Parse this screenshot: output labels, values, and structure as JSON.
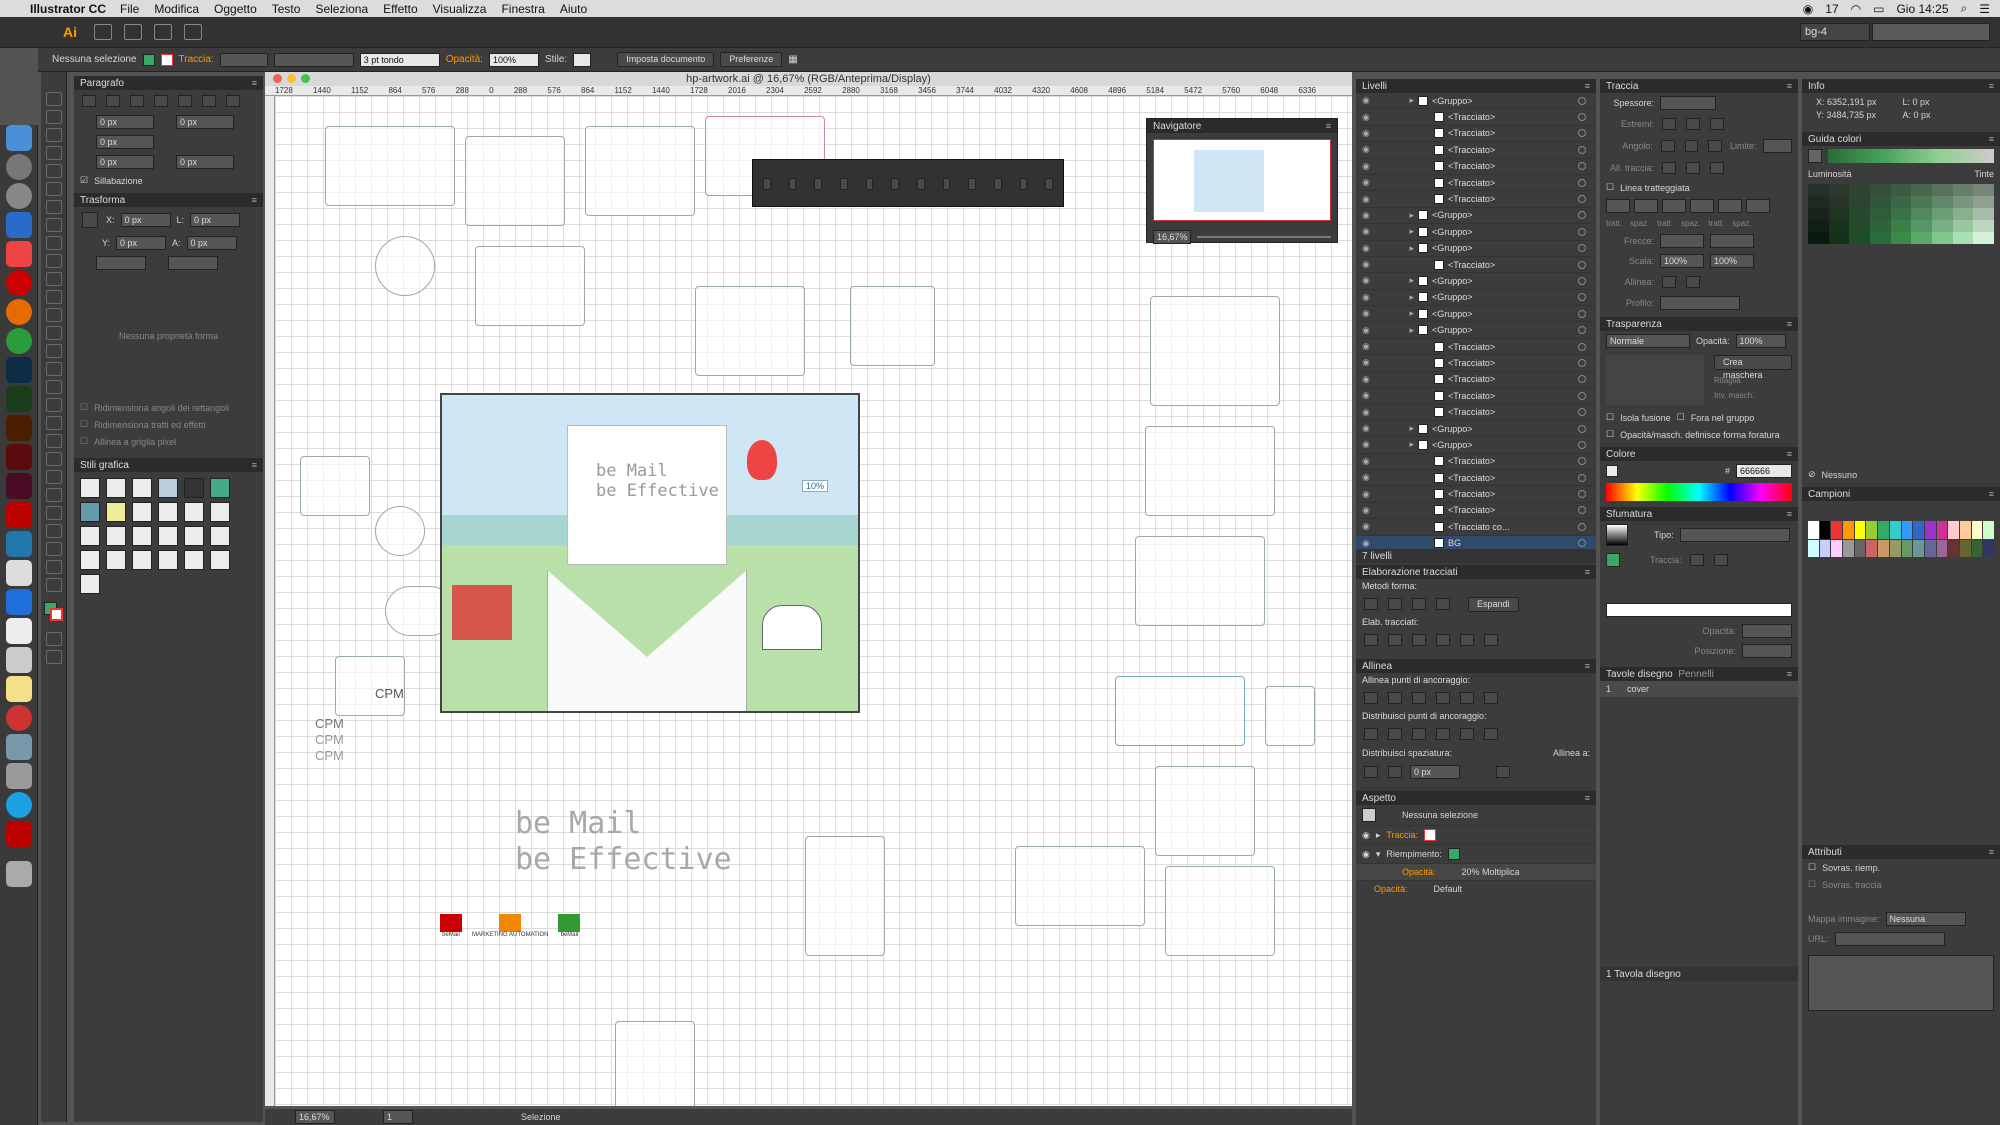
{
  "menubar": {
    "app": "Illustrator CC",
    "items": [
      "File",
      "Modifica",
      "Oggetto",
      "Testo",
      "Seleziona",
      "Effetto",
      "Visualizza",
      "Finestra",
      "Aiuto"
    ],
    "notif_count": "17",
    "clock": "Gio 14:25"
  },
  "appbar": {
    "logo": "Ai",
    "workspace": "bg-4"
  },
  "control": {
    "selection": "Nessuna selezione",
    "stroke_label": "Traccia:",
    "stroke_style": "3 pt tondo",
    "opacity_label": "Opacità:",
    "opacity_value": "100%",
    "style_label": "Stile:",
    "setup_button": "Imposta documento",
    "prefs_button": "Preferenze"
  },
  "paragraph": {
    "title": "Paragrafo",
    "indent_value": "0 px",
    "hyphenation": "Sillabazione"
  },
  "transform": {
    "title": "Trasforma",
    "x_label": "X:",
    "y_label": "Y:",
    "w_label": "L:",
    "h_label": "A:",
    "value": "0 px",
    "no_props": "Nessuna proprietà forma",
    "opt1": "Ridimensiona angoli dei rettangoli",
    "opt2": "Ridimensiona tratti ed effetti",
    "opt3": "Allinea a griglia pixel"
  },
  "graphic_styles": {
    "title": "Stili grafica"
  },
  "document": {
    "title": "hp-artwork.ai @ 16,67% (RGB/Anteprima/Display)",
    "ruler_ticks": [
      "1728",
      "1440",
      "1152",
      "864",
      "576",
      "288",
      "0",
      "288",
      "576",
      "864",
      "1152",
      "1440",
      "1728",
      "2016",
      "2304",
      "2592",
      "2880",
      "3168",
      "3456",
      "3744",
      "4032",
      "4320",
      "4608",
      "4896",
      "5184",
      "5472",
      "5760",
      "6048",
      "6336"
    ],
    "zoom": "16,67%",
    "page": "1",
    "status": "Selezione"
  },
  "artwork": {
    "headline1": "be Mail",
    "headline2": "be Effective",
    "cpm_labels": [
      "CPM",
      "CPM",
      "CPM",
      "CPM"
    ],
    "percent_badge": "10%",
    "logo_labels": [
      "beMail",
      "MARKETING AUTOMATION",
      "beMail"
    ]
  },
  "navigator": {
    "title": "Navigatore",
    "zoom": "16,67%"
  },
  "layers": {
    "title": "Livelli",
    "rows": [
      "<Gruppo>",
      "<Tracciato>",
      "<Tracciato>",
      "<Tracciato>",
      "<Tracciato>",
      "<Tracciato>",
      "<Tracciato>",
      "<Gruppo>",
      "<Gruppo>",
      "<Gruppo>",
      "<Tracciato>",
      "<Gruppo>",
      "<Gruppo>",
      "<Gruppo>",
      "<Gruppo>",
      "<Tracciato>",
      "<Tracciato>",
      "<Tracciato>",
      "<Tracciato>",
      "<Tracciato>",
      "<Gruppo>",
      "<Gruppo>",
      "<Tracciato>",
      "<Tracciato>",
      "<Tracciato>",
      "<Tracciato>",
      "<Tracciato co...",
      "BG"
    ],
    "count": "7 livelli"
  },
  "pathfinder": {
    "title": "Elaborazione tracciati",
    "shape_modes": "Metodi forma:",
    "pathfinders": "Elab. tracciati:",
    "expand": "Espandi"
  },
  "align": {
    "title": "Allinea",
    "align_objects": "Allinea punti di ancoraggio:",
    "distribute_objects": "Distribuisci punti di ancoraggio:",
    "distribute_spacing": "Distribuisci spaziatura:",
    "align_to": "Allinea a:",
    "spacing_value": "0 px"
  },
  "appearance": {
    "title": "Aspetto",
    "selection": "Nessuna selezione",
    "stroke": "Traccia:",
    "fill": "Riempimento:",
    "opacity_label": "Opacità:",
    "opacity_value": "20% Moltiplica",
    "opacity_label2": "Opacità:",
    "opacity_default": "Default"
  },
  "stroke": {
    "title": "Traccia",
    "weight": "Spessore:",
    "cap": "Estremi:",
    "corner": "Angolo:",
    "limit": "Limite:",
    "align": "All. traccia:",
    "dashed": "Linea tratteggiata",
    "dash_labels": [
      "tratt.",
      "spaz.",
      "tratt.",
      "spaz.",
      "tratt.",
      "spaz."
    ],
    "arrows": "Frecce:",
    "scale": "Scala:",
    "scale_value": "100%",
    "align2": "Allinea:",
    "profile": "Profilo:"
  },
  "transparency": {
    "title": "Trasparenza",
    "mode": "Normale",
    "opacity_label": "Opacità:",
    "opacity_value": "100%",
    "make_mask": "Crea maschera",
    "clip": "Ritaglia",
    "invert": "Inv. masch.",
    "isolate": "Isola fusione",
    "knockout": "Fora nel gruppo",
    "define_knockout": "Opacità/masch. definisce forma foratura"
  },
  "color": {
    "title": "Colore",
    "hex": "666666"
  },
  "gradient": {
    "title": "Sfumatura",
    "type_label": "Tipo:",
    "stroke_label": "Traccia:",
    "opacity_label": "Opacità:",
    "location_label": "Posizione:"
  },
  "artboards": {
    "title": "Tavole disegno",
    "tab2": "Pennelli",
    "rows": [
      {
        "num": "1",
        "name": "cover"
      }
    ],
    "count": "1 Tavola disegno"
  },
  "info": {
    "title": "Info",
    "x": "X: 6352,191 px",
    "y": "Y: 3484,735 px",
    "w": "L: 0 px",
    "h": "A: 0 px"
  },
  "color_guide": {
    "title": "Guida colori",
    "luminosity": "Luminosità",
    "tints": "Tinte",
    "none": "Nessuno"
  },
  "swatches": {
    "title": "Campioni"
  },
  "attributes": {
    "title": "Attributi",
    "overprint_fill": "Sovras. riemp.",
    "overprint_stroke": "Sovras. traccia",
    "image_map": "Mappa immagine:",
    "image_map_value": "Nessuna",
    "url": "URL:"
  }
}
